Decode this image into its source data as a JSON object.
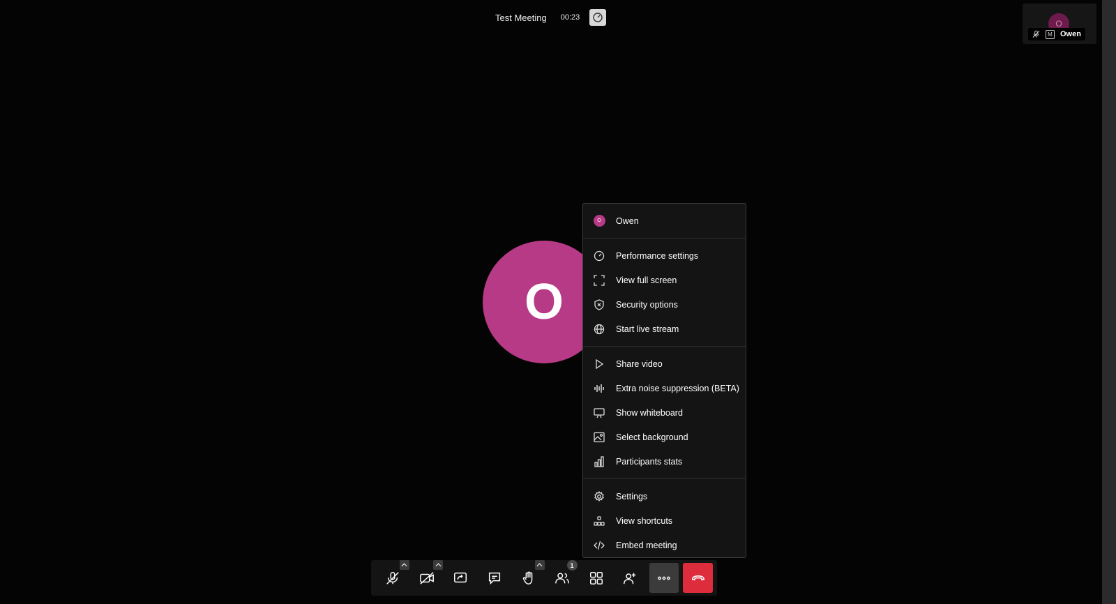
{
  "meeting": {
    "title": "Test Meeting",
    "timer": "00:23"
  },
  "filmstrip": {
    "name": "Owen",
    "initial": "O",
    "moderator_badge": "M"
  },
  "main": {
    "avatar_initial": "O",
    "avatar_color": "#b73a87"
  },
  "menu": {
    "user": {
      "name": "Owen",
      "initial": "O"
    },
    "sections": [
      [
        {
          "label": "Performance settings",
          "icon": "gauge-icon"
        },
        {
          "label": "View full screen",
          "icon": "fullscreen-icon"
        },
        {
          "label": "Security options",
          "icon": "shield-icon"
        },
        {
          "label": "Start live stream",
          "icon": "globe-icon"
        }
      ],
      [
        {
          "label": "Share video",
          "icon": "play-icon"
        },
        {
          "label": "Extra noise suppression (BETA)",
          "icon": "audio-wave-icon"
        },
        {
          "label": "Show whiteboard",
          "icon": "whiteboard-icon"
        },
        {
          "label": "Select background",
          "icon": "image-icon"
        },
        {
          "label": "Participants stats",
          "icon": "bar-chart-icon"
        }
      ],
      [
        {
          "label": "Settings",
          "icon": "gear-icon"
        },
        {
          "label": "View shortcuts",
          "icon": "shortcuts-icon"
        },
        {
          "label": "Embed meeting",
          "icon": "code-icon"
        }
      ]
    ]
  },
  "toolbar": {
    "participants_count": "1",
    "hangup_color": "#dd2c3c"
  }
}
